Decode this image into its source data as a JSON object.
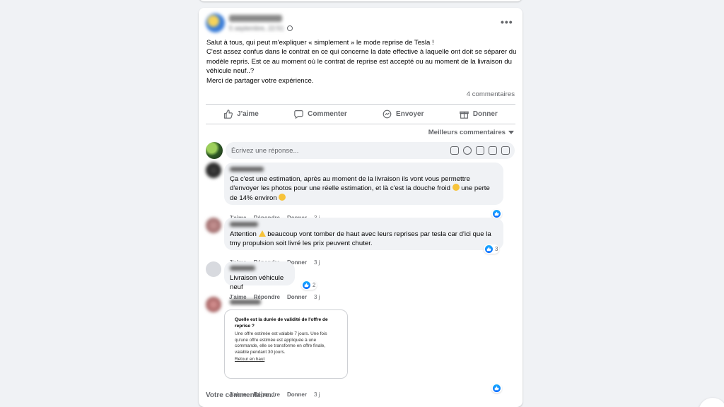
{
  "post": {
    "date": "5 septembre, 22:51",
    "more_label": "•••",
    "text_lines": [
      "Salut à tous, qui peut m'expliquer « simplement » le mode reprise de Tesla !",
      "C'est assez confus dans le contrat en ce qui concerne la date effective à laquelle ont doit se séparer du modèle repris. Est ce au moment où le contrat de reprise est accepté ou au moment de la livraison du véhicule neuf..?",
      "Merci de partager votre expérience."
    ],
    "comments_count": "4 commentaires"
  },
  "actions": {
    "like": "J'aime",
    "comment": "Commenter",
    "send": "Envoyer",
    "give": "Donner"
  },
  "sort_label": "Meilleurs commentaires",
  "reply_placeholder": "Écrivez une réponse...",
  "comments": [
    {
      "text_a": "Ça c'est une estimation, après au moment de la livraison ils vont vous permettre d'envoyer les photos pour une réelle estimation, et là c'est la douche froid",
      "text_b": " une perte de 14% environ",
      "like": "J'aime",
      "reply": "Répondre",
      "give": "Donner",
      "time": "3 j",
      "reactions": ""
    },
    {
      "text_a": "Attention",
      "text_b": " beaucoup vont tomber de haut avec leurs reprises par tesla car d'ici que la tmy propulsion soit livré les prix peuvent chuter.",
      "like": "J'aime",
      "reply": "Répondre",
      "give": "Donner",
      "time": "3 j",
      "reactions": "3"
    },
    {
      "text_a": "Livraison véhicule neuf",
      "like": "J'aime",
      "reply": "Répondre",
      "give": "Donner",
      "time": "3 j",
      "reactions": "2"
    },
    {
      "card_question": "Quelle est la durée de validité de l'offre de reprise ?",
      "card_answer": "Une offre estimée est valable 7 jours. Une fois qu'une offre estimée est appliquée à une commande, elle se transforme en offre finale, valable pendant 30 jours.",
      "card_back": "Retour en haut",
      "like": "J'aime",
      "reply": "Répondre",
      "give": "Donner",
      "time": "3 j",
      "reactions": ""
    }
  ],
  "your_comment": "Votre commentaire...",
  "colors": {
    "like_blue": "#0566ff",
    "bubble_bg": "#f0f2f5",
    "secondary_text": "#65676b"
  },
  "icons": [
    "like-icon",
    "comment-icon",
    "messenger-icon",
    "gift-icon",
    "emoji-icon",
    "camera-icon",
    "gif-icon",
    "sticker-icon",
    "globe-icon"
  ]
}
